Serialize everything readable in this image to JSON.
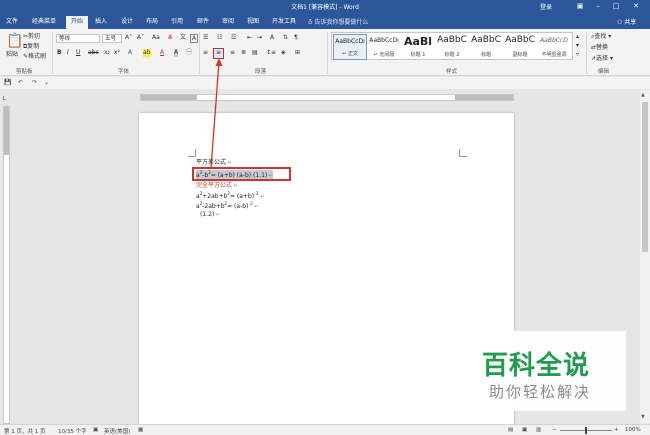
{
  "titlebar": {
    "title": "文档1 [兼容模式] - Word",
    "login": "登录"
  },
  "tabs": [
    {
      "label": "文件"
    },
    {
      "label": "经典菜单"
    },
    {
      "label": "开始"
    },
    {
      "label": "插入"
    },
    {
      "label": "设计"
    },
    {
      "label": "布局"
    },
    {
      "label": "引用"
    },
    {
      "label": "邮件"
    },
    {
      "label": "审阅"
    },
    {
      "label": "视图"
    },
    {
      "label": "开发工具"
    }
  ],
  "tellme": "告诉我你想要做什么",
  "share": "共享",
  "ribbon": {
    "clipboard": {
      "paste": "粘贴",
      "cut": "剪切",
      "copy": "复制",
      "format_painter": "格式刷",
      "label": "剪贴板"
    },
    "font": {
      "name": "等线",
      "size": "五号",
      "label": "字体"
    },
    "paragraph": {
      "label": "段落"
    },
    "styles": {
      "label": "样式",
      "items": [
        {
          "sample": "AaBbCcDı",
          "name": "↵ 正文"
        },
        {
          "sample": "AaBbCcDı",
          "name": "↵ 无间隔"
        },
        {
          "sample": "AaBl",
          "name": "标题 1"
        },
        {
          "sample": "AaBbC",
          "name": "标题 2"
        },
        {
          "sample": "AaBbC",
          "name": "标题"
        },
        {
          "sample": "AaBbC",
          "name": "副标题"
        },
        {
          "sample": "AaBbCcD",
          "name": "不明显强调"
        }
      ]
    },
    "editing": {
      "find": "查找",
      "replace": "替换",
      "select": "选择",
      "label": "编辑"
    }
  },
  "document": {
    "line1": "平方差公式",
    "line2": {
      "a": "a",
      "e1": "2",
      "b": "-b",
      "e2": "2",
      "rest": "= (a+b) (a-b) (1.1)"
    },
    "line3": "完全平方公式",
    "line4": {
      "a": "a",
      "e1": "2",
      "mid": "+2ab+b",
      "e2": "2",
      "eq": "= (a+b) ",
      "e3": "2"
    },
    "line5": {
      "a": "a",
      "e1": "2",
      "mid": "-2ab+b",
      "e2": "2",
      "eq": "= (a-b) ",
      "e3": "2"
    },
    "line6": "(1.2)"
  },
  "status": {
    "page": "第 1 页，共 1 页",
    "words": "10/35 个字",
    "lang": "英语(美国)",
    "zoom": "100%"
  },
  "watermark": {
    "title": "百科全说",
    "subtitle": "助你轻松解决"
  },
  "colors": {
    "brand": "#2b579a",
    "annotation": "#d0342c",
    "watermark": "#1f9d4c"
  }
}
